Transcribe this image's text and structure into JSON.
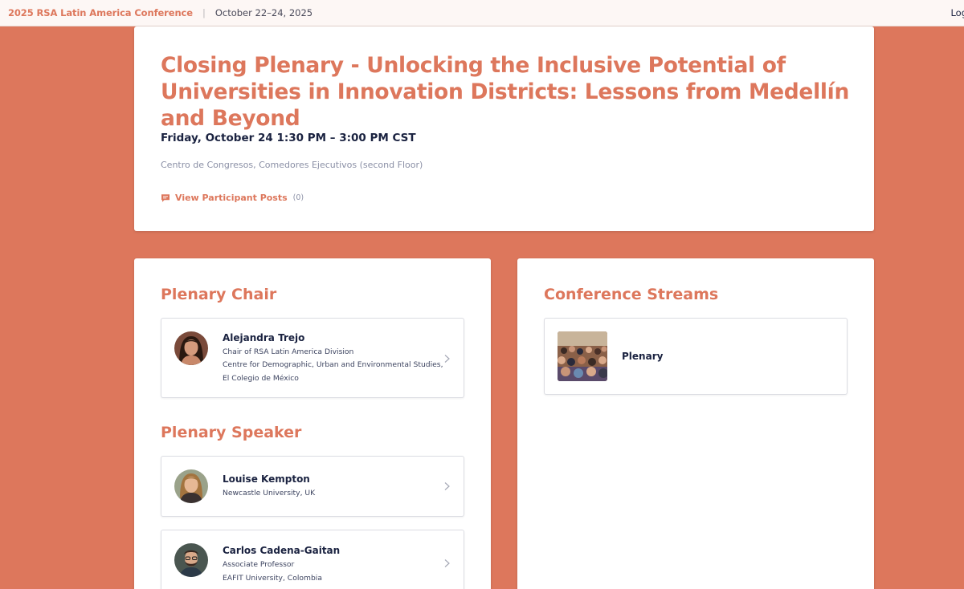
{
  "topbar": {
    "conference_title": "2025 RSA Latin America Conference",
    "separator": "|",
    "dates": "October 22–24, 2025",
    "login": "Log"
  },
  "session": {
    "title": "Closing Plenary - Unlocking the Inclusive Potential of Universities in Innovation Districts: Lessons from Medellín and Beyond",
    "time": "Friday, October 24 1:30 PM – 3:00 PM CST",
    "location": "Centro de Congresos, Comedores Ejecutivos (second Floor)",
    "posts_label": "View Participant Posts",
    "posts_count": "(0)"
  },
  "chair_section": {
    "title": "Plenary Chair",
    "people": [
      {
        "name": "Alejandra Trejo",
        "lines": [
          "Chair of RSA Latin America Division",
          "Centre for Demographic, Urban and Environmental Studies,",
          "El Colegio de México"
        ]
      }
    ]
  },
  "speaker_section": {
    "title": "Plenary Speaker",
    "people": [
      {
        "name": "Louise Kempton",
        "lines": [
          "Newcastle University, UK"
        ]
      },
      {
        "name": "Carlos Cadena-Gaitan",
        "lines": [
          "Associate Professor",
          "EAFIT University, Colombia"
        ]
      }
    ]
  },
  "streams_section": {
    "title": "Conference Streams",
    "streams": [
      {
        "name": "Plenary"
      }
    ]
  },
  "colors": {
    "accent": "#dd775c",
    "navy": "#1a2240",
    "muted": "#8a8fa5"
  }
}
